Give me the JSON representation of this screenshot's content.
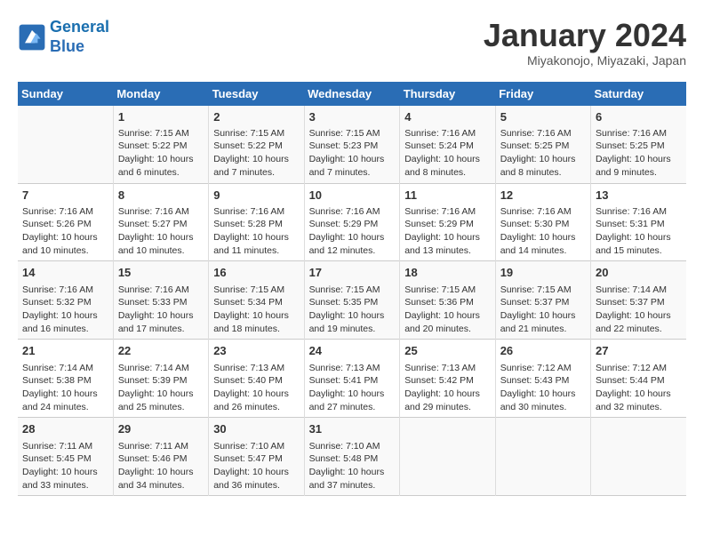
{
  "header": {
    "logo_line1": "General",
    "logo_line2": "Blue",
    "month_title": "January 2024",
    "location": "Miyakonojo, Miyazaki, Japan"
  },
  "days_of_week": [
    "Sunday",
    "Monday",
    "Tuesday",
    "Wednesday",
    "Thursday",
    "Friday",
    "Saturday"
  ],
  "weeks": [
    [
      {
        "day": "",
        "content": ""
      },
      {
        "day": "1",
        "content": "Sunrise: 7:15 AM\nSunset: 5:22 PM\nDaylight: 10 hours\nand 6 minutes."
      },
      {
        "day": "2",
        "content": "Sunrise: 7:15 AM\nSunset: 5:22 PM\nDaylight: 10 hours\nand 7 minutes."
      },
      {
        "day": "3",
        "content": "Sunrise: 7:15 AM\nSunset: 5:23 PM\nDaylight: 10 hours\nand 7 minutes."
      },
      {
        "day": "4",
        "content": "Sunrise: 7:16 AM\nSunset: 5:24 PM\nDaylight: 10 hours\nand 8 minutes."
      },
      {
        "day": "5",
        "content": "Sunrise: 7:16 AM\nSunset: 5:25 PM\nDaylight: 10 hours\nand 8 minutes."
      },
      {
        "day": "6",
        "content": "Sunrise: 7:16 AM\nSunset: 5:25 PM\nDaylight: 10 hours\nand 9 minutes."
      }
    ],
    [
      {
        "day": "7",
        "content": "Sunrise: 7:16 AM\nSunset: 5:26 PM\nDaylight: 10 hours\nand 10 minutes."
      },
      {
        "day": "8",
        "content": "Sunrise: 7:16 AM\nSunset: 5:27 PM\nDaylight: 10 hours\nand 10 minutes."
      },
      {
        "day": "9",
        "content": "Sunrise: 7:16 AM\nSunset: 5:28 PM\nDaylight: 10 hours\nand 11 minutes."
      },
      {
        "day": "10",
        "content": "Sunrise: 7:16 AM\nSunset: 5:29 PM\nDaylight: 10 hours\nand 12 minutes."
      },
      {
        "day": "11",
        "content": "Sunrise: 7:16 AM\nSunset: 5:29 PM\nDaylight: 10 hours\nand 13 minutes."
      },
      {
        "day": "12",
        "content": "Sunrise: 7:16 AM\nSunset: 5:30 PM\nDaylight: 10 hours\nand 14 minutes."
      },
      {
        "day": "13",
        "content": "Sunrise: 7:16 AM\nSunset: 5:31 PM\nDaylight: 10 hours\nand 15 minutes."
      }
    ],
    [
      {
        "day": "14",
        "content": "Sunrise: 7:16 AM\nSunset: 5:32 PM\nDaylight: 10 hours\nand 16 minutes."
      },
      {
        "day": "15",
        "content": "Sunrise: 7:16 AM\nSunset: 5:33 PM\nDaylight: 10 hours\nand 17 minutes."
      },
      {
        "day": "16",
        "content": "Sunrise: 7:15 AM\nSunset: 5:34 PM\nDaylight: 10 hours\nand 18 minutes."
      },
      {
        "day": "17",
        "content": "Sunrise: 7:15 AM\nSunset: 5:35 PM\nDaylight: 10 hours\nand 19 minutes."
      },
      {
        "day": "18",
        "content": "Sunrise: 7:15 AM\nSunset: 5:36 PM\nDaylight: 10 hours\nand 20 minutes."
      },
      {
        "day": "19",
        "content": "Sunrise: 7:15 AM\nSunset: 5:37 PM\nDaylight: 10 hours\nand 21 minutes."
      },
      {
        "day": "20",
        "content": "Sunrise: 7:14 AM\nSunset: 5:37 PM\nDaylight: 10 hours\nand 22 minutes."
      }
    ],
    [
      {
        "day": "21",
        "content": "Sunrise: 7:14 AM\nSunset: 5:38 PM\nDaylight: 10 hours\nand 24 minutes."
      },
      {
        "day": "22",
        "content": "Sunrise: 7:14 AM\nSunset: 5:39 PM\nDaylight: 10 hours\nand 25 minutes."
      },
      {
        "day": "23",
        "content": "Sunrise: 7:13 AM\nSunset: 5:40 PM\nDaylight: 10 hours\nand 26 minutes."
      },
      {
        "day": "24",
        "content": "Sunrise: 7:13 AM\nSunset: 5:41 PM\nDaylight: 10 hours\nand 27 minutes."
      },
      {
        "day": "25",
        "content": "Sunrise: 7:13 AM\nSunset: 5:42 PM\nDaylight: 10 hours\nand 29 minutes."
      },
      {
        "day": "26",
        "content": "Sunrise: 7:12 AM\nSunset: 5:43 PM\nDaylight: 10 hours\nand 30 minutes."
      },
      {
        "day": "27",
        "content": "Sunrise: 7:12 AM\nSunset: 5:44 PM\nDaylight: 10 hours\nand 32 minutes."
      }
    ],
    [
      {
        "day": "28",
        "content": "Sunrise: 7:11 AM\nSunset: 5:45 PM\nDaylight: 10 hours\nand 33 minutes."
      },
      {
        "day": "29",
        "content": "Sunrise: 7:11 AM\nSunset: 5:46 PM\nDaylight: 10 hours\nand 34 minutes."
      },
      {
        "day": "30",
        "content": "Sunrise: 7:10 AM\nSunset: 5:47 PM\nDaylight: 10 hours\nand 36 minutes."
      },
      {
        "day": "31",
        "content": "Sunrise: 7:10 AM\nSunset: 5:48 PM\nDaylight: 10 hours\nand 37 minutes."
      },
      {
        "day": "",
        "content": ""
      },
      {
        "day": "",
        "content": ""
      },
      {
        "day": "",
        "content": ""
      }
    ]
  ]
}
